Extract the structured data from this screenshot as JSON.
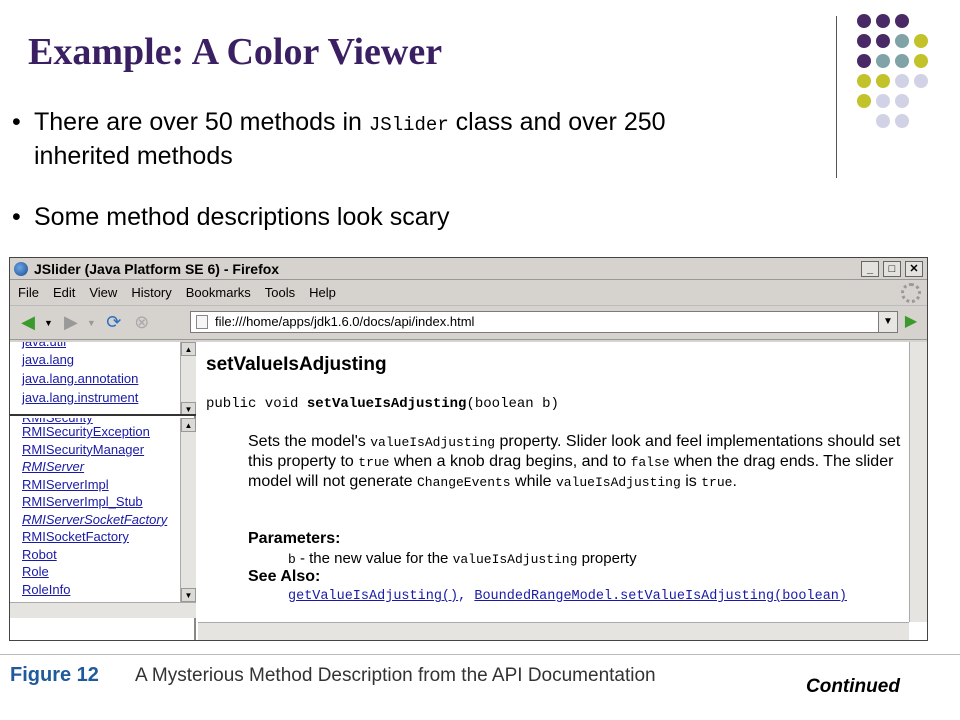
{
  "slide": {
    "title": "Example: A Color Viewer",
    "bullet1_pre": "There are over 50 methods in ",
    "bullet1_code": "JSlider",
    "bullet1_post": " class and over 250",
    "bullet1_line2": "inherited methods",
    "bullet2": "Some method descriptions look scary",
    "continued": "Continued"
  },
  "colors": {
    "title": "#3a1f63",
    "dot_purple": "#4a2a66",
    "dot_teal": "#7fa3a6",
    "dot_olive": "#c2c22a",
    "dot_lavender": "#d2d2e6",
    "link": "#1a1aa8",
    "figure_label": "#1f5a9b"
  },
  "window": {
    "title": "JSlider (Java Platform SE 6) - Firefox",
    "menu": [
      "File",
      "Edit",
      "View",
      "History",
      "Bookmarks",
      "Tools",
      "Help"
    ],
    "url": "file:///home/apps/jdk1.6.0/docs/api/index.html"
  },
  "packages": [
    "java.lang",
    "java.lang.annotation",
    "java.lang.instrument"
  ],
  "classes": [
    {
      "name": "RMISecurityException",
      "italic": false
    },
    {
      "name": "RMISecurityManager",
      "italic": false
    },
    {
      "name": "RMIServer",
      "italic": true
    },
    {
      "name": "RMIServerImpl",
      "italic": false
    },
    {
      "name": "RMIServerImpl_Stub",
      "italic": false
    },
    {
      "name": "RMIServerSocketFactory",
      "italic": true
    },
    {
      "name": "RMISocketFactory",
      "italic": false
    },
    {
      "name": "Robot",
      "italic": false
    },
    {
      "name": "Role",
      "italic": false
    },
    {
      "name": "RoleInfo",
      "italic": false
    }
  ],
  "doc": {
    "heading": "setValueIsAdjusting",
    "sig_pre": "public void ",
    "sig_name": "setValueIsAdjusting",
    "sig_post": "(boolean b)",
    "d1": "Sets the model's ",
    "d2": "valueIsAdjusting",
    "d3": " property. Slider look and feel implementations should set this property to ",
    "d4": "true",
    "d5": " when a knob drag begins, and to ",
    "d6": "false",
    "d7": " when the drag ends. The slider model will not generate ",
    "d8": "ChangeEvents",
    "d9": " while ",
    "d10": "valueIsAdjusting",
    "d11": " is ",
    "d12": "true",
    "d13": ".",
    "params_label": "Parameters:",
    "param_code": "b",
    "param_mid": " - the new value for the ",
    "param_code2": "valueIsAdjusting",
    "param_end": " property",
    "see_label": "See Also:",
    "see1": "getValueIsAdjusting()",
    "see_sep": ", ",
    "see2": "BoundedRangeModel.setValueIsAdjusting(boolean)"
  },
  "figure": {
    "label": "Figure 12",
    "caption": "A Mysterious Method Description from the API Documentation"
  }
}
